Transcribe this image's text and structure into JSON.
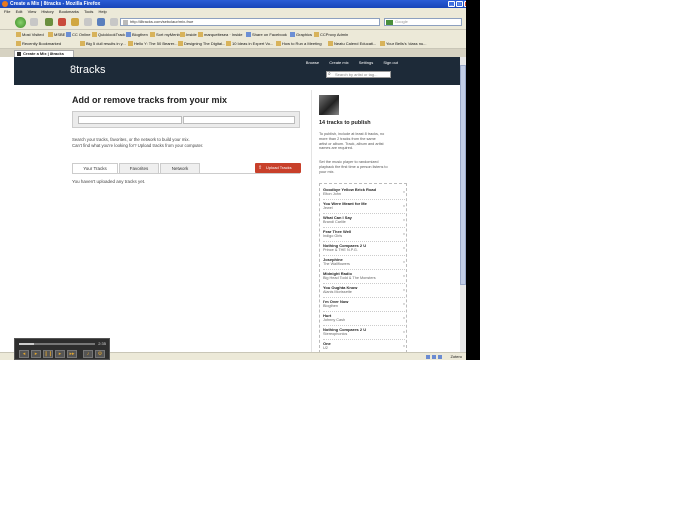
{
  "window": {
    "title": "Create a Mix | 8tracks - Mozilla Firefox"
  },
  "menu": [
    "File",
    "Edit",
    "View",
    "History",
    "Bookmarks",
    "Tools",
    "Help"
  ],
  "nav": {
    "url": "http://8tracks.com/sebclaur/mix-frue",
    "search_placeholder": "Google"
  },
  "bookmarks_row1": [
    "Most Visited",
    "MSBE",
    "CC Online",
    "QuicklookTrack",
    "Blogthen",
    "Sort myMenbers",
    "Inside",
    "marqueltesea · Inside",
    "Share on Facebook",
    "Graphics",
    "CCProxy Admin"
  ],
  "bookmarks_row2": [
    "Recently Bookmarked",
    "Big 5 dull results in y...",
    "Hello Y: The 50 Bearer...",
    "Designing The Digital...",
    "10 Ideas in Expert Vo...",
    "How to Run a Meeting",
    "Neatu Calend Educati...",
    "Your Bells's 'class nu..."
  ],
  "tab": {
    "label": "Create a Mix | 8tracks"
  },
  "site": {
    "logo": "8tracks",
    "links": [
      "Browse",
      "Create mix",
      "Settings",
      "Sign out"
    ],
    "search_placeholder": "Search by artist or tag..."
  },
  "main": {
    "heading": "Add or remove tracks from your mix",
    "help_lines": [
      "Search your tracks, favorites, or the network to build your mix.",
      "Can't find what you're looking for? Upload tracks from your computer."
    ],
    "tabs": [
      "Your Tracks",
      "Favorites",
      "Network"
    ],
    "upload_label": "Upload Tracks",
    "empty_message": "You haven't uploaded any tracks yet."
  },
  "sidebar": {
    "publish_title": "14 tracks to publish",
    "rules_lines": [
      "To publish, include at least 8 tracks, no",
      "more than 2 tracks from the same",
      "artist or album. Track, album and artist",
      "names are required."
    ],
    "rules2_lines": [
      "Set the music player to randomized",
      "playback the first time a person listens to",
      "your mix."
    ],
    "tracks": [
      {
        "title": "Goodbye Yellow Brick Road",
        "artist": "Elton John"
      },
      {
        "title": "You Were Meant for Me",
        "artist": "Jewel"
      },
      {
        "title": "What Can I Say",
        "artist": "Brandi Carlile"
      },
      {
        "title": "Fear Thee Well",
        "artist": "Indigo Girls"
      },
      {
        "title": "Nothing Compares 2 U",
        "artist": "Prince & THE N.P.G."
      },
      {
        "title": "Josephine",
        "artist": "The Wallflowers"
      },
      {
        "title": "Midnight Radio",
        "artist": "Big Head Todd & The Monsters"
      },
      {
        "title": "You Oughta Know",
        "artist": "Alanis Morissette"
      },
      {
        "title": "I'm Over Now",
        "artist": "Blogthen"
      },
      {
        "title": "Hurt",
        "artist": "Johnny Cash"
      },
      {
        "title": "Nothing Compares 2 U",
        "artist": "Stereophonics"
      },
      {
        "title": "One",
        "artist": "U2"
      }
    ],
    "remove_glyph": "x",
    "feedback": "feedback"
  },
  "status": {
    "text": "Zotero"
  },
  "player": {
    "time": "2:35",
    "progress": 0.2
  }
}
